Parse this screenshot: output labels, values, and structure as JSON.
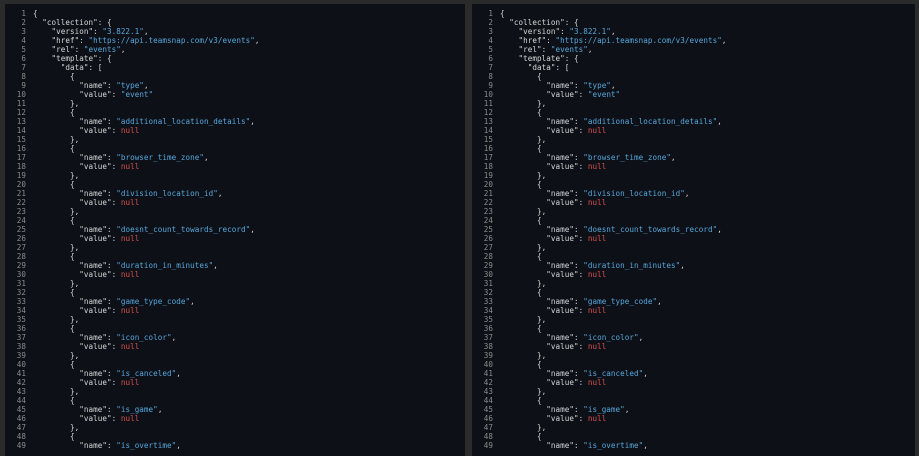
{
  "colors": {
    "background": "#2b2b2b",
    "pane": "#0d1117",
    "text": "#d6d6d6",
    "line_number": "#8b8b8b",
    "string": "#58a6dc",
    "null": "#d9514e"
  },
  "json_lines": [
    {
      "n": "1",
      "t": [
        {
          "k": "p",
          "v": "{"
        }
      ]
    },
    {
      "n": "2",
      "t": [
        {
          "k": "p",
          "v": "  \"collection\": {"
        }
      ]
    },
    {
      "n": "3",
      "t": [
        {
          "k": "p",
          "v": "    \"version\": "
        },
        {
          "k": "s",
          "v": "\"3.822.1\""
        },
        {
          "k": "p",
          "v": ","
        }
      ]
    },
    {
      "n": "4",
      "t": [
        {
          "k": "p",
          "v": "    \"href\": "
        },
        {
          "k": "s",
          "v": "\"https://api.teamsnap.com/v3/events\""
        },
        {
          "k": "p",
          "v": ","
        }
      ]
    },
    {
      "n": "5",
      "t": [
        {
          "k": "p",
          "v": "    \"rel\": "
        },
        {
          "k": "s",
          "v": "\"events\""
        },
        {
          "k": "p",
          "v": ","
        }
      ]
    },
    {
      "n": "6",
      "t": [
        {
          "k": "p",
          "v": "    \"template\": {"
        }
      ]
    },
    {
      "n": "7",
      "t": [
        {
          "k": "p",
          "v": "      \"data\": ["
        }
      ]
    },
    {
      "n": "8",
      "t": [
        {
          "k": "p",
          "v": "        {"
        }
      ]
    },
    {
      "n": "9",
      "t": [
        {
          "k": "p",
          "v": "          \"name\": "
        },
        {
          "k": "s",
          "v": "\"type\""
        },
        {
          "k": "p",
          "v": ","
        }
      ]
    },
    {
      "n": "10",
      "t": [
        {
          "k": "p",
          "v": "          \"value\": "
        },
        {
          "k": "s",
          "v": "\"event\""
        }
      ]
    },
    {
      "n": "11",
      "t": [
        {
          "k": "p",
          "v": "        },"
        }
      ]
    },
    {
      "n": "12",
      "t": [
        {
          "k": "p",
          "v": "        {"
        }
      ]
    },
    {
      "n": "13",
      "t": [
        {
          "k": "p",
          "v": "          \"name\": "
        },
        {
          "k": "s",
          "v": "\"additional_location_details\""
        },
        {
          "k": "p",
          "v": ","
        }
      ]
    },
    {
      "n": "14",
      "t": [
        {
          "k": "p",
          "v": "          \"value\": "
        },
        {
          "k": "n",
          "v": "null"
        }
      ]
    },
    {
      "n": "15",
      "t": [
        {
          "k": "p",
          "v": "        },"
        }
      ]
    },
    {
      "n": "16",
      "t": [
        {
          "k": "p",
          "v": "        {"
        }
      ]
    },
    {
      "n": "17",
      "t": [
        {
          "k": "p",
          "v": "          \"name\": "
        },
        {
          "k": "s",
          "v": "\"browser_time_zone\""
        },
        {
          "k": "p",
          "v": ","
        }
      ]
    },
    {
      "n": "18",
      "t": [
        {
          "k": "p",
          "v": "          \"value\": "
        },
        {
          "k": "n",
          "v": "null"
        }
      ]
    },
    {
      "n": "19",
      "t": [
        {
          "k": "p",
          "v": "        },"
        }
      ]
    },
    {
      "n": "20",
      "t": [
        {
          "k": "p",
          "v": "        {"
        }
      ]
    },
    {
      "n": "21",
      "t": [
        {
          "k": "p",
          "v": "          \"name\": "
        },
        {
          "k": "s",
          "v": "\"division_location_id\""
        },
        {
          "k": "p",
          "v": ","
        }
      ]
    },
    {
      "n": "22",
      "t": [
        {
          "k": "p",
          "v": "          \"value\": "
        },
        {
          "k": "n",
          "v": "null"
        }
      ]
    },
    {
      "n": "23",
      "t": [
        {
          "k": "p",
          "v": "        },"
        }
      ]
    },
    {
      "n": "24",
      "t": [
        {
          "k": "p",
          "v": "        {"
        }
      ]
    },
    {
      "n": "25",
      "t": [
        {
          "k": "p",
          "v": "          \"name\": "
        },
        {
          "k": "s",
          "v": "\"doesnt_count_towards_record\""
        },
        {
          "k": "p",
          "v": ","
        }
      ]
    },
    {
      "n": "26",
      "t": [
        {
          "k": "p",
          "v": "          \"value\": "
        },
        {
          "k": "n",
          "v": "null"
        }
      ]
    },
    {
      "n": "27",
      "t": [
        {
          "k": "p",
          "v": "        },"
        }
      ]
    },
    {
      "n": "28",
      "t": [
        {
          "k": "p",
          "v": "        {"
        }
      ]
    },
    {
      "n": "29",
      "t": [
        {
          "k": "p",
          "v": "          \"name\": "
        },
        {
          "k": "s",
          "v": "\"duration_in_minutes\""
        },
        {
          "k": "p",
          "v": ","
        }
      ]
    },
    {
      "n": "30",
      "t": [
        {
          "k": "p",
          "v": "          \"value\": "
        },
        {
          "k": "n",
          "v": "null"
        }
      ]
    },
    {
      "n": "31",
      "t": [
        {
          "k": "p",
          "v": "        },"
        }
      ]
    },
    {
      "n": "32",
      "t": [
        {
          "k": "p",
          "v": "        {"
        }
      ]
    },
    {
      "n": "33",
      "t": [
        {
          "k": "p",
          "v": "          \"name\": "
        },
        {
          "k": "s",
          "v": "\"game_type_code\""
        },
        {
          "k": "p",
          "v": ","
        }
      ]
    },
    {
      "n": "34",
      "t": [
        {
          "k": "p",
          "v": "          \"value\": "
        },
        {
          "k": "n",
          "v": "null"
        }
      ]
    },
    {
      "n": "35",
      "t": [
        {
          "k": "p",
          "v": "        },"
        }
      ]
    },
    {
      "n": "36",
      "t": [
        {
          "k": "p",
          "v": "        {"
        }
      ]
    },
    {
      "n": "37",
      "t": [
        {
          "k": "p",
          "v": "          \"name\": "
        },
        {
          "k": "s",
          "v": "\"icon_color\""
        },
        {
          "k": "p",
          "v": ","
        }
      ]
    },
    {
      "n": "38",
      "t": [
        {
          "k": "p",
          "v": "          \"value\": "
        },
        {
          "k": "n",
          "v": "null"
        }
      ]
    },
    {
      "n": "39",
      "t": [
        {
          "k": "p",
          "v": "        },"
        }
      ]
    },
    {
      "n": "40",
      "t": [
        {
          "k": "p",
          "v": "        {"
        }
      ]
    },
    {
      "n": "41",
      "t": [
        {
          "k": "p",
          "v": "          \"name\": "
        },
        {
          "k": "s",
          "v": "\"is_canceled\""
        },
        {
          "k": "p",
          "v": ","
        }
      ]
    },
    {
      "n": "42",
      "t": [
        {
          "k": "p",
          "v": "          \"value\": "
        },
        {
          "k": "n",
          "v": "null"
        }
      ]
    },
    {
      "n": "43",
      "t": [
        {
          "k": "p",
          "v": "        },"
        }
      ]
    },
    {
      "n": "44",
      "t": [
        {
          "k": "p",
          "v": "        {"
        }
      ]
    },
    {
      "n": "45",
      "t": [
        {
          "k": "p",
          "v": "          \"name\": "
        },
        {
          "k": "s",
          "v": "\"is_game\""
        },
        {
          "k": "p",
          "v": ","
        }
      ]
    },
    {
      "n": "46",
      "t": [
        {
          "k": "p",
          "v": "          \"value\": "
        },
        {
          "k": "n",
          "v": "null"
        }
      ]
    },
    {
      "n": "47",
      "t": [
        {
          "k": "p",
          "v": "        },"
        }
      ]
    },
    {
      "n": "48",
      "t": [
        {
          "k": "p",
          "v": "        {"
        }
      ]
    },
    {
      "n": "49",
      "t": [
        {
          "k": "p",
          "v": "          \"name\": "
        },
        {
          "k": "s",
          "v": "\"is_overtime\""
        },
        {
          "k": "p",
          "v": ","
        }
      ]
    }
  ]
}
